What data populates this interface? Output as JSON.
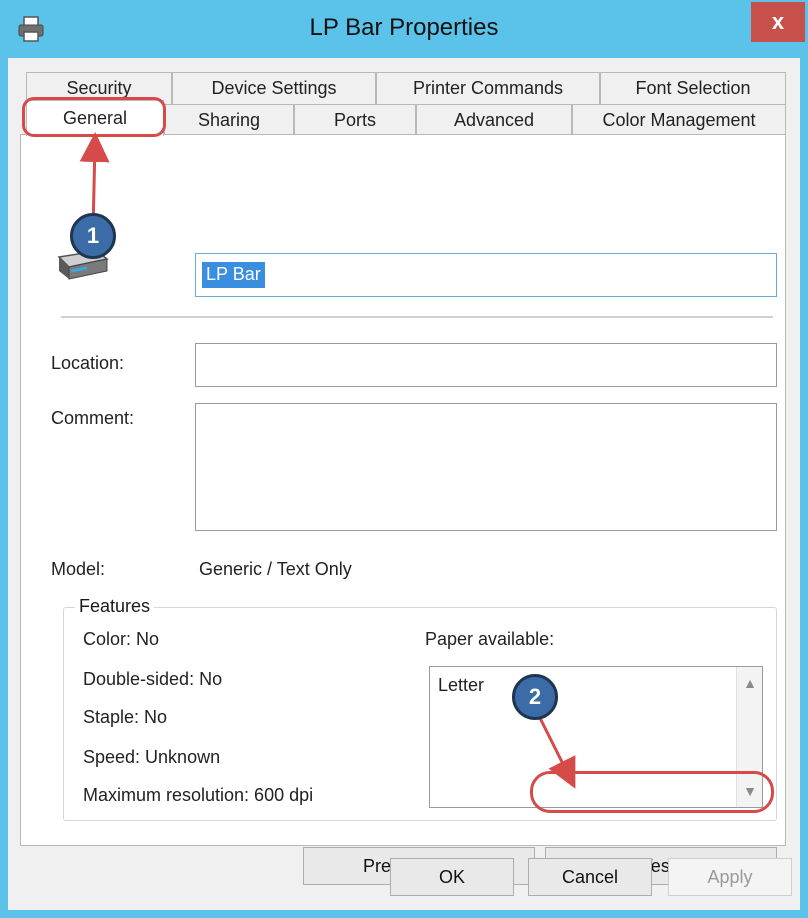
{
  "window": {
    "title": "LP Bar Properties",
    "close_glyph": "x",
    "title_icon": "printer-icon"
  },
  "tabs": {
    "row1": [
      {
        "label": "Security"
      },
      {
        "label": "Device Settings"
      },
      {
        "label": "Printer Commands"
      },
      {
        "label": "Font Selection"
      }
    ],
    "row2": [
      {
        "label": "General",
        "active": true
      },
      {
        "label": "Sharing"
      },
      {
        "label": "Ports"
      },
      {
        "label": "Advanced"
      },
      {
        "label": "Color Management"
      }
    ]
  },
  "general": {
    "printer_icon": "printer-icon",
    "printer_name": "LP Bar",
    "location_label": "Location:",
    "location_value": "",
    "comment_label": "Comment:",
    "comment_value": "",
    "model_label": "Model:",
    "model_value": "Generic / Text Only"
  },
  "features": {
    "title": "Features",
    "items": [
      {
        "text": "Color: No"
      },
      {
        "text": "Double-sided: No"
      },
      {
        "text": "Staple: No"
      },
      {
        "text": "Speed: Unknown"
      },
      {
        "text": "Maximum resolution: 600 dpi"
      }
    ],
    "paper_label": "Paper available:",
    "paper_options": [
      "Letter"
    ]
  },
  "buttons": {
    "preferences": "Preferences...",
    "print_test_page": "Print Test Page",
    "ok": "OK",
    "cancel": "Cancel",
    "apply": "Apply"
  },
  "annotations": {
    "step1": "1",
    "step2": "2",
    "color": "#d64a4a",
    "badge_color": "#3c6ca8"
  },
  "colors": {
    "titlebar": "#5bc3ea",
    "selection": "#3a8ee0"
  }
}
